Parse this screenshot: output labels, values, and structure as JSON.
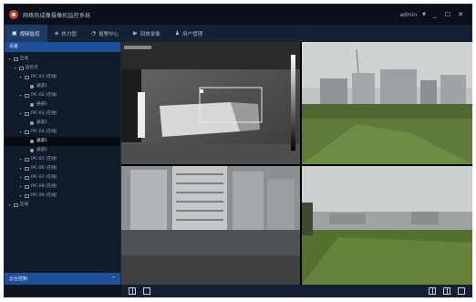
{
  "app": {
    "title": "网络热成像摄像机监控系统"
  },
  "titlebar": {
    "user": "admin",
    "minimize": "_",
    "maximize": "☐",
    "close": "✕"
  },
  "nav": {
    "tabs": [
      {
        "label": "视频监控",
        "icon": "monitor-icon"
      },
      {
        "label": "热力图",
        "icon": "heatmap-icon"
      },
      {
        "label": "报警中心",
        "icon": "alarm-icon"
      },
      {
        "label": "回放录像",
        "icon": "playback-icon"
      },
      {
        "label": "用户管理",
        "icon": "user-icon"
      }
    ]
  },
  "sidebar": {
    "header": "设备",
    "tree": [
      {
        "label": "区域",
        "depth": 0
      },
      {
        "label": "监控点",
        "depth": 1
      },
      {
        "label": "IPC-01 (在线)",
        "depth": 2
      },
      {
        "label": "通道1",
        "depth": 3
      },
      {
        "label": "IPC-02 (在线)",
        "depth": 2
      },
      {
        "label": "通道1",
        "depth": 3
      },
      {
        "label": "IPC-03 (在线)",
        "depth": 2
      },
      {
        "label": "通道1",
        "depth": 3
      },
      {
        "label": "IPC-04 (在线)",
        "depth": 2
      },
      {
        "label": "通道1",
        "depth": 3
      },
      {
        "label": "通道2",
        "depth": 3
      },
      {
        "label": "IPC-05 (在线)",
        "depth": 2
      },
      {
        "label": "IPC-06 (在线)",
        "depth": 2
      },
      {
        "label": "IPC-07 (在线)",
        "depth": 2
      },
      {
        "label": "IPC-08 (在线)",
        "depth": 2
      },
      {
        "label": "IPC-09 (在线)",
        "depth": 2
      },
      {
        "label": "区域",
        "depth": 0
      }
    ],
    "footer": "云台控制",
    "footer_caret": "^"
  },
  "colors": {
    "accent": "#1e4f9a",
    "tab_active": "#1f3a66",
    "roi": "#e8e8e8"
  }
}
